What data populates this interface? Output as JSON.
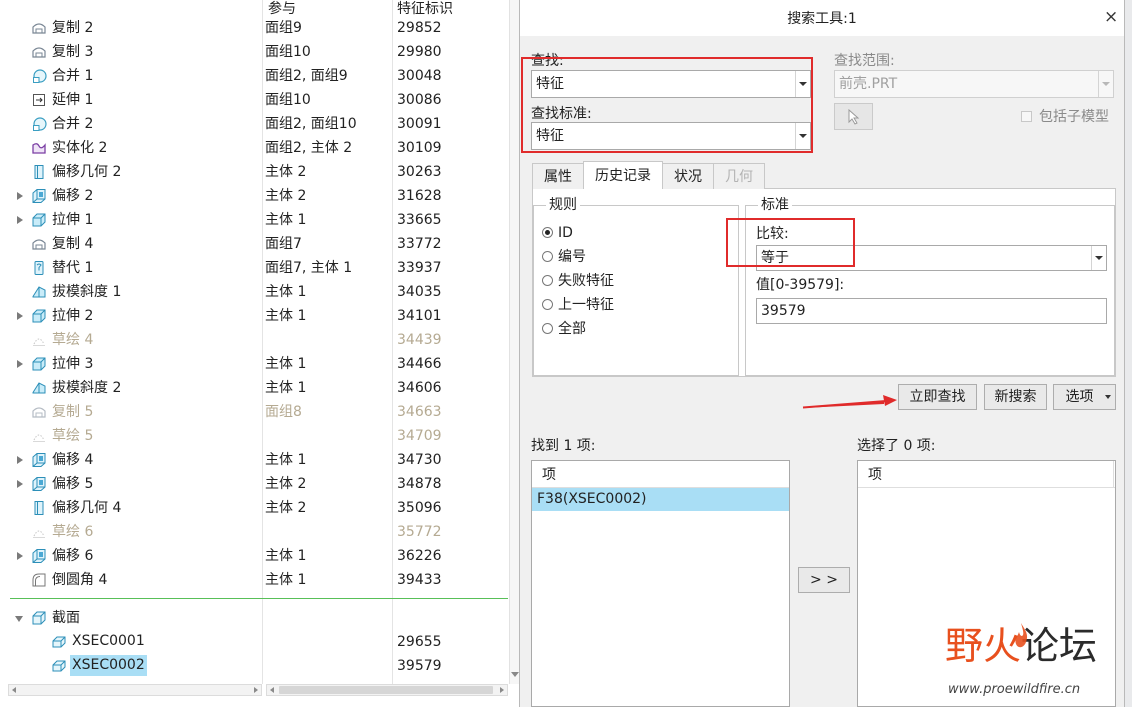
{
  "tree": {
    "columns": {
      "ref": "参与",
      "id": "特征标识"
    },
    "rows": [
      {
        "name": "复制 2",
        "icon": "copy-icon",
        "expandable": false,
        "ref": "面组9",
        "id": "29852",
        "dim": false
      },
      {
        "name": "复制 3",
        "icon": "copy-icon",
        "expandable": false,
        "ref": "面组10",
        "id": "29980",
        "dim": false
      },
      {
        "name": "合并 1",
        "icon": "merge-icon",
        "expandable": false,
        "ref": "面组2, 面组9",
        "id": "30048",
        "dim": false
      },
      {
        "name": "延伸 1",
        "icon": "extend-icon",
        "expandable": false,
        "ref": "面组10",
        "id": "30086",
        "dim": false
      },
      {
        "name": "合并 2",
        "icon": "merge-icon",
        "expandable": false,
        "ref": "面组2, 面组10",
        "id": "30091",
        "dim": false
      },
      {
        "name": "实体化 2",
        "icon": "solidify-icon",
        "expandable": false,
        "ref": "面组2, 主体 2",
        "id": "30109",
        "dim": false
      },
      {
        "name": "偏移几何 2",
        "icon": "offset-geometry-icon",
        "expandable": false,
        "ref": "主体 2",
        "id": "30263",
        "dim": false
      },
      {
        "name": "偏移 2",
        "icon": "offset-icon",
        "expandable": true,
        "ref": "主体 2",
        "id": "31628",
        "dim": false
      },
      {
        "name": "拉伸 1",
        "icon": "extrude-icon",
        "expandable": true,
        "ref": "主体 1",
        "id": "33665",
        "dim": false
      },
      {
        "name": "复制 4",
        "icon": "copy-icon",
        "expandable": false,
        "ref": "面组7",
        "id": "33772",
        "dim": false
      },
      {
        "name": "替代 1",
        "icon": "replace-icon",
        "expandable": false,
        "ref": "面组7, 主体 1",
        "id": "33937",
        "dim": false
      },
      {
        "name": "拔模斜度 1",
        "icon": "draft-icon",
        "expandable": false,
        "ref": "主体 1",
        "id": "34035",
        "dim": false
      },
      {
        "name": "拉伸 2",
        "icon": "extrude-icon",
        "expandable": true,
        "ref": "主体 1",
        "id": "34101",
        "dim": false
      },
      {
        "name": "草绘 4",
        "icon": "sketch-icon",
        "expandable": false,
        "ref": "",
        "id": "34439",
        "dim": true
      },
      {
        "name": "拉伸 3",
        "icon": "extrude-icon",
        "expandable": true,
        "ref": "主体 1",
        "id": "34466",
        "dim": false
      },
      {
        "name": "拔模斜度 2",
        "icon": "draft-icon",
        "expandable": false,
        "ref": "主体 1",
        "id": "34606",
        "dim": false
      },
      {
        "name": "复制 5",
        "icon": "copy-icon",
        "expandable": false,
        "ref": "面组8",
        "id": "34663",
        "dim": true
      },
      {
        "name": "草绘 5",
        "icon": "sketch-icon",
        "expandable": false,
        "ref": "",
        "id": "34709",
        "dim": true
      },
      {
        "name": "偏移 4",
        "icon": "offset-icon",
        "expandable": true,
        "ref": "主体 1",
        "id": "34730",
        "dim": false
      },
      {
        "name": "偏移 5",
        "icon": "offset-icon",
        "expandable": true,
        "ref": "主体 2",
        "id": "34878",
        "dim": false
      },
      {
        "name": "偏移几何 4",
        "icon": "offset-geometry-icon",
        "expandable": false,
        "ref": "主体 2",
        "id": "35096",
        "dim": false
      },
      {
        "name": "草绘 6",
        "icon": "sketch-icon",
        "expandable": false,
        "ref": "",
        "id": "35772",
        "dim": true
      },
      {
        "name": "偏移 6",
        "icon": "offset-icon",
        "expandable": true,
        "ref": "主体 1",
        "id": "36226",
        "dim": false
      },
      {
        "name": "倒圆角 4",
        "icon": "round-icon",
        "expandable": false,
        "ref": "主体 1",
        "id": "39433",
        "dim": false
      }
    ],
    "section": {
      "name": "截面",
      "icon": "section-folder-icon",
      "expanded": true,
      "items": [
        {
          "name": "XSEC0001",
          "icon": "xsec-icon",
          "id": "29655",
          "selected": false
        },
        {
          "name": "XSEC0002",
          "icon": "xsec-icon",
          "id": "39579",
          "selected": true
        }
      ]
    }
  },
  "dialog": {
    "title": "搜索工具:1",
    "close_label": "×",
    "look_for_label": "查找:",
    "look_for_value": "特征",
    "criteria_label": "查找标准:",
    "criteria_value": "特征",
    "look_in_label": "查找范围:",
    "look_in_value": "前壳.PRT",
    "include_submodels_label": "包括子模型",
    "include_submodels_checked": false,
    "tabs": [
      {
        "label": "属性",
        "active": false,
        "disabled": false
      },
      {
        "label": "历史记录",
        "active": true,
        "disabled": false
      },
      {
        "label": "状况",
        "active": false,
        "disabled": false
      },
      {
        "label": "几何",
        "active": false,
        "disabled": true
      }
    ],
    "rules": {
      "legend": "规则",
      "options": [
        "ID",
        "编号",
        "失败特征",
        "上一特征",
        "全部"
      ],
      "selected": "ID"
    },
    "criteria": {
      "legend": "标准",
      "compare_label": "比较:",
      "compare_value": "等于",
      "value_label": "值[0-39579]:",
      "value": "39579"
    },
    "buttons": {
      "find_now": "立即查找",
      "new_search": "新搜索",
      "options": "选项"
    },
    "found_label": "找到 1 项:",
    "found_header": "项",
    "found_items": [
      {
        "label": "F38(XSEC0002)",
        "selected": true
      }
    ],
    "transfer_label": "> >",
    "selected_label": "选择了 0 项:",
    "selected_header": "项",
    "selected_items": []
  },
  "watermark": {
    "title_part1": "野火",
    "title_part2": "论坛",
    "url": "www.proewildfire.cn"
  },
  "colors": {
    "selection": "#a9def5",
    "dim_text": "#b5aa92",
    "annotation": "#e02b2b",
    "insert_line": "#58c058",
    "watermark_red": "#e8501e"
  }
}
